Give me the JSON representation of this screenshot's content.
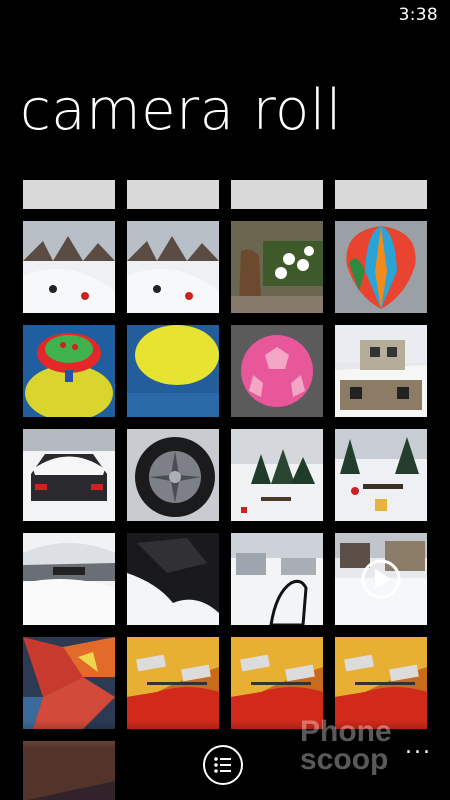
{
  "status_bar": {
    "time": "3:38"
  },
  "header": {
    "title": "camera roll"
  },
  "photos": [
    {
      "kind": "top-partial",
      "label": "snow scene"
    },
    {
      "kind": "top-partial",
      "label": "snow scene"
    },
    {
      "kind": "top-partial",
      "label": "snow scene"
    },
    {
      "kind": "top-partial",
      "label": "snow scene"
    },
    {
      "kind": "snow-hill",
      "label": "kids sledding"
    },
    {
      "kind": "snow-hill",
      "label": "kids sledding"
    },
    {
      "kind": "daisies",
      "label": "daisies and statue"
    },
    {
      "kind": "balloon",
      "label": "hot air balloon decoration"
    },
    {
      "kind": "yellow-toy",
      "label": "yellow toy"
    },
    {
      "kind": "yellow-blur",
      "label": "yellow toy closeup"
    },
    {
      "kind": "pink-ball",
      "label": "pink soccer ball"
    },
    {
      "kind": "house",
      "label": "house roof"
    },
    {
      "kind": "snow-car",
      "label": "snowy car"
    },
    {
      "kind": "tire",
      "label": "car tire"
    },
    {
      "kind": "snow-trees",
      "label": "snowy trees"
    },
    {
      "kind": "snow-trees2",
      "label": "snowy yard"
    },
    {
      "kind": "snow-car2",
      "label": "car in snow"
    },
    {
      "kind": "snow-dark",
      "label": "dark snow"
    },
    {
      "kind": "snow-street",
      "label": "snowy street"
    },
    {
      "kind": "snow-video",
      "label": "video snow house"
    },
    {
      "kind": "cloth",
      "label": "colorful fabric"
    },
    {
      "kind": "guitar",
      "label": "guitar"
    },
    {
      "kind": "guitar",
      "label": "guitar"
    },
    {
      "kind": "guitar",
      "label": "guitar"
    },
    {
      "kind": "bottom-partial",
      "label": "colorful"
    }
  ],
  "app_bar": {
    "select_icon": "list-select-icon",
    "more_label": "..."
  },
  "watermark": {
    "line1": "Phone",
    "line2": "scoop"
  }
}
